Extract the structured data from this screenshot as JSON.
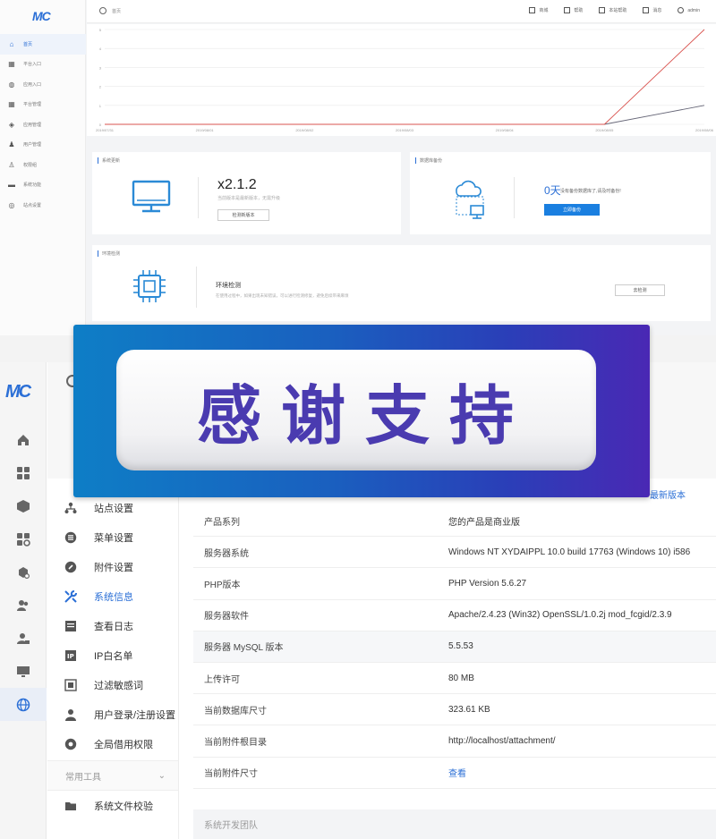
{
  "top": {
    "logo": "MC",
    "nav": [
      {
        "label": "首页",
        "icon": "home-icon",
        "active": true
      },
      {
        "label": "平台入口",
        "icon": "grid-icon"
      },
      {
        "label": "应用入口",
        "icon": "box-icon"
      },
      {
        "label": "平台管理",
        "icon": "apps-icon"
      },
      {
        "label": "应用管理",
        "icon": "cube-icon"
      },
      {
        "label": "用户管理",
        "icon": "users-icon"
      },
      {
        "label": "权限组",
        "icon": "user-lock-icon"
      },
      {
        "label": "系统功能",
        "icon": "monitor-icon"
      },
      {
        "label": "站点设置",
        "icon": "globe-icon"
      }
    ],
    "header": {
      "crumb": "首页",
      "toolbar": [
        {
          "label": "商城",
          "icon": "store-icon"
        },
        {
          "label": "帮助",
          "icon": "help-icon"
        },
        {
          "label": "本站帮助",
          "icon": "book-icon"
        },
        {
          "label": "消息",
          "icon": "bell-icon"
        },
        {
          "label": "admin",
          "icon": "user-icon"
        }
      ]
    },
    "chart": {
      "xticks": [
        "2019/07/31",
        "2019/08/01",
        "2019/08/02",
        "2019/08/03",
        "2019/08/04",
        "2019/08/05",
        "2019/08/06"
      ],
      "yticks": [
        "0",
        "1",
        "2",
        "3",
        "4",
        "5"
      ]
    },
    "sys_card": {
      "title": "系统更新",
      "version": "x2.1.2",
      "sub": "当前版本是最新版本，无需升级",
      "button": "检测新版本"
    },
    "backup_card": {
      "title": "数据库备份",
      "days": "0天",
      "sub": "没有备份数据库了,请及时备份!",
      "button": "立即备份"
    },
    "env_card": {
      "title": "环境检测",
      "heading": "环境检测",
      "sub": "在使用过程中，如果出现未知错误，可以进行检测修复，避免后续带来麻烦",
      "button": "去检测"
    }
  },
  "bottom": {
    "logo": "MC",
    "rail_icons": [
      "home-icon",
      "grid-icon",
      "box-icon",
      "apps-icon",
      "cube-icon",
      "users-icon",
      "user-lock-icon",
      "monitor-icon",
      "globe-icon"
    ],
    "menu": [
      {
        "label": "站点设置",
        "icon": "sitemap-icon"
      },
      {
        "label": "菜单设置",
        "icon": "list-icon"
      },
      {
        "label": "附件设置",
        "icon": "attachment-icon"
      },
      {
        "label": "系统信息",
        "icon": "tools-icon",
        "active": true
      },
      {
        "label": "查看日志",
        "icon": "log-icon"
      },
      {
        "label": "IP白名单",
        "icon": "ip-icon"
      },
      {
        "label": "过滤敏感词",
        "icon": "filter-icon"
      },
      {
        "label": "用户登录/注册设置",
        "icon": "user-icon"
      },
      {
        "label": "全局借用权限",
        "icon": "permission-icon"
      }
    ],
    "section": "常用工具",
    "tools": [
      {
        "label": "系统文件校验",
        "icon": "folder-icon"
      }
    ],
    "top_link": "最新版本",
    "rows": [
      {
        "k": "产品系列",
        "v": "您的产品是商业版"
      },
      {
        "k": "服务器系统",
        "v": "Windows NT XYDAIPPL 10.0 build 17763 (Windows 10) i586"
      },
      {
        "k": "PHP版本",
        "v": "PHP Version 5.6.27"
      },
      {
        "k": "服务器软件",
        "v": "Apache/2.4.23 (Win32) OpenSSL/1.0.2j mod_fcgid/2.3.9"
      },
      {
        "k": "服务器 MySQL 版本",
        "v": "5.5.53"
      },
      {
        "k": "上传许可",
        "v": "80 MB"
      },
      {
        "k": "当前数据库尺寸",
        "v": "323.61 KB"
      },
      {
        "k": "当前附件根目录",
        "v": "http://localhost/attachment/"
      },
      {
        "k": "当前附件尺寸",
        "v": "查看"
      }
    ],
    "team": "系统开发团队"
  },
  "banner": {
    "text": "感谢支持",
    "colors": {
      "gradient_start": "#0e7ec6",
      "gradient_end": "#4a28b4",
      "text": "#4a3bb0"
    }
  }
}
